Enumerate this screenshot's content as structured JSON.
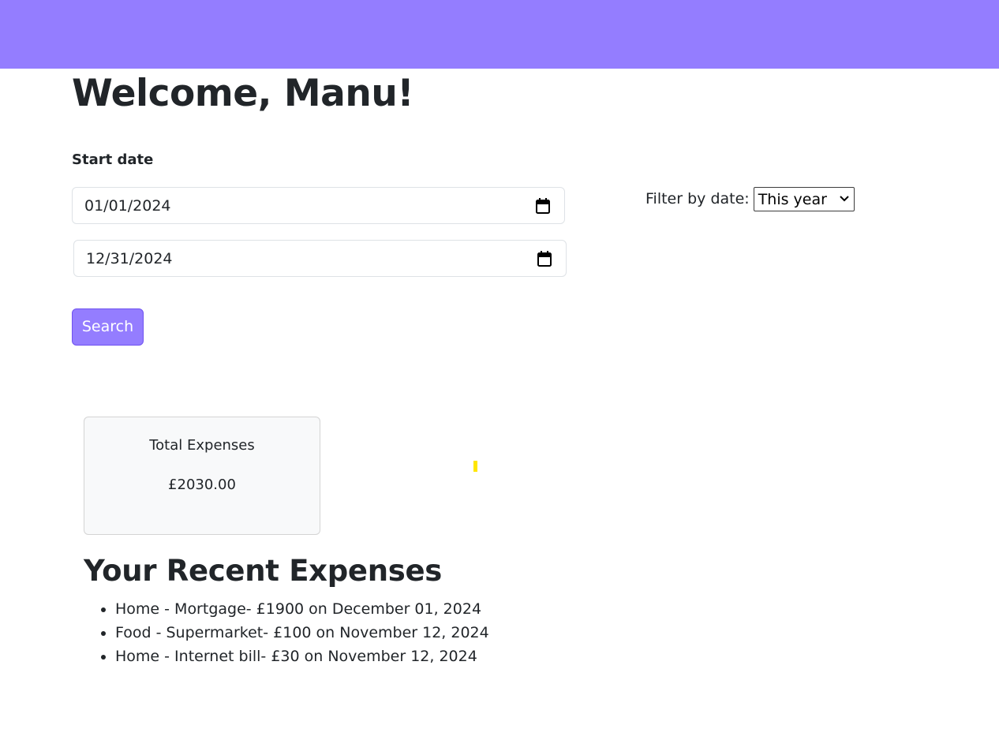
{
  "colors": {
    "brand": "#947dff",
    "card_bg": "#f8f9fa",
    "chart_mark": "#ffe600"
  },
  "header": {
    "welcome": "Welcome, Manu!"
  },
  "date_filter": {
    "start_label": "Start date",
    "start_value": "01/01/2024",
    "end_value": "12/31/2024",
    "search_label": "Search"
  },
  "quick_filter": {
    "label": "Filter by date:",
    "selected": "This year"
  },
  "summary": {
    "title": "Total Expenses",
    "value": "£2030.00"
  },
  "recent": {
    "title": "Your Recent Expenses",
    "items": [
      "Home - Mortgage- £1900 on December 01, 2024",
      "Food - Supermarket- £100 on November 12, 2024",
      "Home - Internet bill- £30 on November 12, 2024"
    ]
  }
}
